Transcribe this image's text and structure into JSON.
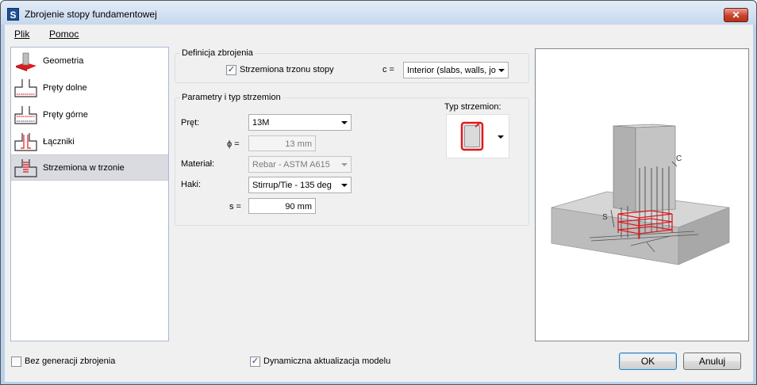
{
  "window": {
    "title": "Zbrojenie stopy fundamentowej",
    "app_icon_letter": "S",
    "close_symbol": "✕"
  },
  "menu": [
    {
      "label": "Plik"
    },
    {
      "label": "Pomoc"
    }
  ],
  "sidebar": {
    "items": [
      {
        "label": "Geometria",
        "icon": "footing-geometry-icon"
      },
      {
        "label": "Pręty dolne",
        "icon": "bottom-bars-icon"
      },
      {
        "label": "Pręty górne",
        "icon": "top-bars-icon"
      },
      {
        "label": "Łączniki",
        "icon": "dowels-icon"
      },
      {
        "label": "Strzemiona w trzonie",
        "icon": "pier-stirrups-icon",
        "selected": true
      }
    ]
  },
  "definition": {
    "group_title": "Definicja zbrojenia",
    "stirrups_checkbox_label": "Strzemiona trzonu stopy",
    "stirrups_checked": true,
    "c_label": "c =",
    "c_value": "Interior (slabs, walls, jois"
  },
  "params": {
    "group_title": "Parametry i typ strzemion",
    "bar_label": "Pręt:",
    "bar_value": "13M",
    "phi_label": "ϕ =",
    "phi_value": "13 mm",
    "material_label": "Materiał:",
    "material_value": "Rebar - ASTM A615",
    "hooks_label": "Haki:",
    "hooks_value": "Stirrup/Tie - 135 deg",
    "s_label": "s =",
    "s_value": "90 mm",
    "stirrup_type_label": "Typ strzemion:"
  },
  "preview": {
    "label_c": "C",
    "label_s": "S"
  },
  "footer": {
    "no_generation_label": "Bez generacji zbrojenia",
    "no_generation_checked": false,
    "dynamic_update_label": "Dynamiczna aktualizacja modelu",
    "dynamic_update_checked": true,
    "ok_label": "OK",
    "cancel_label": "Anuluj"
  },
  "colors": {
    "rebar_red": "#e0191f",
    "concrete_gray": "#c8c8c8",
    "selection": "#dadbe0"
  }
}
